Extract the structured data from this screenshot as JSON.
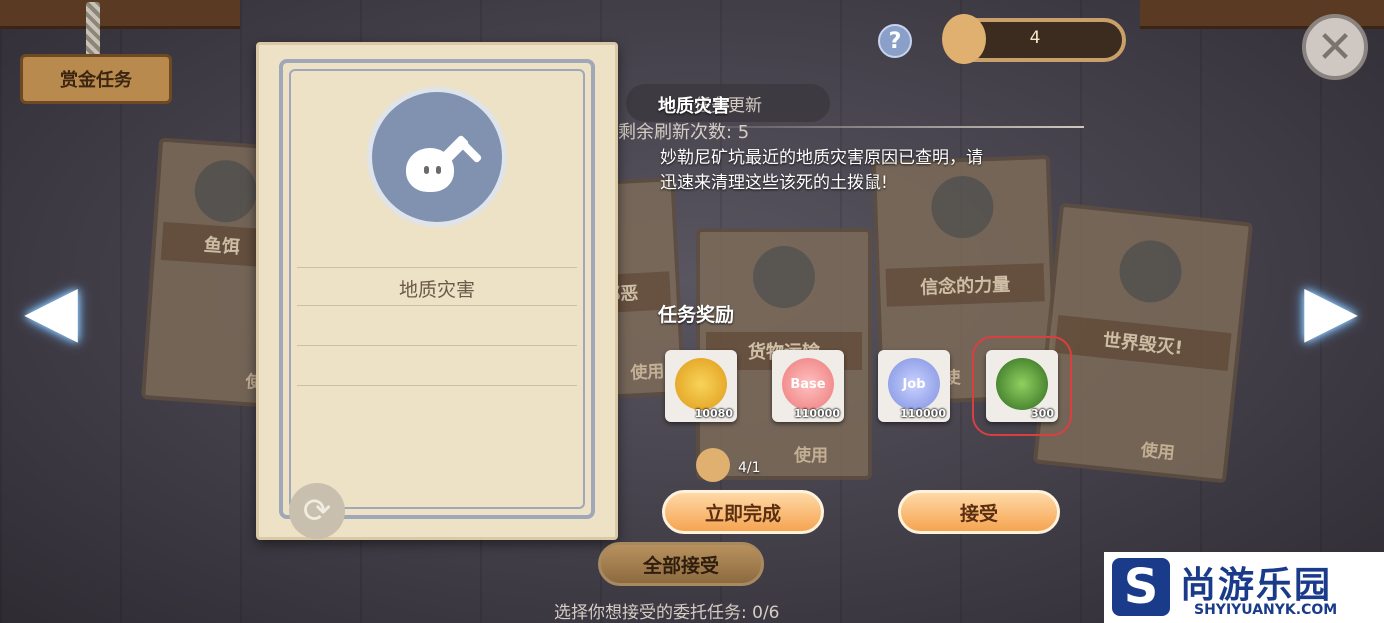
{
  "header": {
    "bounty_sign": "赏金任务",
    "help_icon": "?",
    "currency_count": "4"
  },
  "background_cards": [
    {
      "name": "鱼饵",
      "use": "使"
    },
    {
      "name": "邪恶",
      "use": "使用"
    },
    {
      "name": "货物运输",
      "use": "使用"
    },
    {
      "name": "信念的力量",
      "use": "使"
    },
    {
      "name": "世界毁灭!",
      "use": "使用"
    }
  ],
  "behind_panel": {
    "refresh_button": "任务更新",
    "remaining_refresh": "剩余刷新次数: 5"
  },
  "main_card": {
    "title": "地质灾害"
  },
  "quest": {
    "name": "地质灾害",
    "description_line1": "妙勒尼矿坑最近的地质灾害原因已查明，请",
    "description_line2": "迅速来清理这些该死的土拨鼠!",
    "rewards_label": "任务奖励",
    "rewards": [
      {
        "icon": "zeny-coin-icon",
        "count": "10080",
        "color": "#f2b82a"
      },
      {
        "icon": "base-exp-star-icon",
        "count": "110000",
        "color": "#f28b8b",
        "label": "Base"
      },
      {
        "icon": "job-exp-star-icon",
        "count": "110000",
        "color": "#8fa0e8",
        "label": "Job"
      },
      {
        "icon": "green-crown-icon",
        "count": "300",
        "color": "#3f8a2a"
      }
    ],
    "item_count": "4/1",
    "complete_now": "立即完成",
    "accept": "接受"
  },
  "footer": {
    "accept_all": "全部接受",
    "select_hint": "选择你想接受的委托任务: 0/6"
  },
  "watermark": {
    "logo_letter": "S",
    "brand": "尚游乐园",
    "url": "SHYIYUANYK.COM"
  }
}
